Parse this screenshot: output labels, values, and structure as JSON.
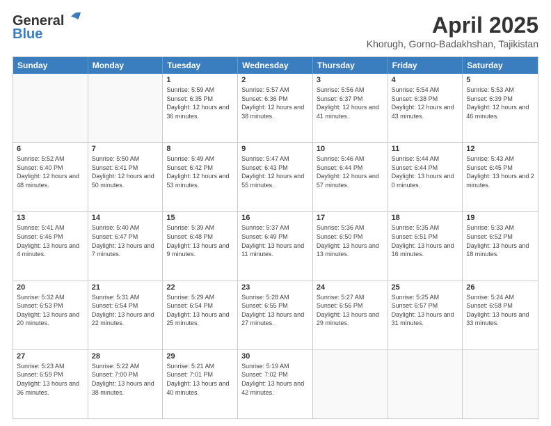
{
  "logo": {
    "line1": "General",
    "line2": "Blue"
  },
  "title": "April 2025",
  "subtitle": "Khorugh, Gorno-Badakhshan, Tajikistan",
  "headers": [
    "Sunday",
    "Monday",
    "Tuesday",
    "Wednesday",
    "Thursday",
    "Friday",
    "Saturday"
  ],
  "weeks": [
    [
      {
        "day": "",
        "info": ""
      },
      {
        "day": "",
        "info": ""
      },
      {
        "day": "1",
        "info": "Sunrise: 5:59 AM\nSunset: 6:35 PM\nDaylight: 12 hours and 36 minutes."
      },
      {
        "day": "2",
        "info": "Sunrise: 5:57 AM\nSunset: 6:36 PM\nDaylight: 12 hours and 38 minutes."
      },
      {
        "day": "3",
        "info": "Sunrise: 5:56 AM\nSunset: 6:37 PM\nDaylight: 12 hours and 41 minutes."
      },
      {
        "day": "4",
        "info": "Sunrise: 5:54 AM\nSunset: 6:38 PM\nDaylight: 12 hours and 43 minutes."
      },
      {
        "day": "5",
        "info": "Sunrise: 5:53 AM\nSunset: 6:39 PM\nDaylight: 12 hours and 46 minutes."
      }
    ],
    [
      {
        "day": "6",
        "info": "Sunrise: 5:52 AM\nSunset: 6:40 PM\nDaylight: 12 hours and 48 minutes."
      },
      {
        "day": "7",
        "info": "Sunrise: 5:50 AM\nSunset: 6:41 PM\nDaylight: 12 hours and 50 minutes."
      },
      {
        "day": "8",
        "info": "Sunrise: 5:49 AM\nSunset: 6:42 PM\nDaylight: 12 hours and 53 minutes."
      },
      {
        "day": "9",
        "info": "Sunrise: 5:47 AM\nSunset: 6:43 PM\nDaylight: 12 hours and 55 minutes."
      },
      {
        "day": "10",
        "info": "Sunrise: 5:46 AM\nSunset: 6:44 PM\nDaylight: 12 hours and 57 minutes."
      },
      {
        "day": "11",
        "info": "Sunrise: 5:44 AM\nSunset: 6:44 PM\nDaylight: 13 hours and 0 minutes."
      },
      {
        "day": "12",
        "info": "Sunrise: 5:43 AM\nSunset: 6:45 PM\nDaylight: 13 hours and 2 minutes."
      }
    ],
    [
      {
        "day": "13",
        "info": "Sunrise: 5:41 AM\nSunset: 6:46 PM\nDaylight: 13 hours and 4 minutes."
      },
      {
        "day": "14",
        "info": "Sunrise: 5:40 AM\nSunset: 6:47 PM\nDaylight: 13 hours and 7 minutes."
      },
      {
        "day": "15",
        "info": "Sunrise: 5:39 AM\nSunset: 6:48 PM\nDaylight: 13 hours and 9 minutes."
      },
      {
        "day": "16",
        "info": "Sunrise: 5:37 AM\nSunset: 6:49 PM\nDaylight: 13 hours and 11 minutes."
      },
      {
        "day": "17",
        "info": "Sunrise: 5:36 AM\nSunset: 6:50 PM\nDaylight: 13 hours and 13 minutes."
      },
      {
        "day": "18",
        "info": "Sunrise: 5:35 AM\nSunset: 6:51 PM\nDaylight: 13 hours and 16 minutes."
      },
      {
        "day": "19",
        "info": "Sunrise: 5:33 AM\nSunset: 6:52 PM\nDaylight: 13 hours and 18 minutes."
      }
    ],
    [
      {
        "day": "20",
        "info": "Sunrise: 5:32 AM\nSunset: 6:53 PM\nDaylight: 13 hours and 20 minutes."
      },
      {
        "day": "21",
        "info": "Sunrise: 5:31 AM\nSunset: 6:54 PM\nDaylight: 13 hours and 22 minutes."
      },
      {
        "day": "22",
        "info": "Sunrise: 5:29 AM\nSunset: 6:54 PM\nDaylight: 13 hours and 25 minutes."
      },
      {
        "day": "23",
        "info": "Sunrise: 5:28 AM\nSunset: 6:55 PM\nDaylight: 13 hours and 27 minutes."
      },
      {
        "day": "24",
        "info": "Sunrise: 5:27 AM\nSunset: 6:56 PM\nDaylight: 13 hours and 29 minutes."
      },
      {
        "day": "25",
        "info": "Sunrise: 5:25 AM\nSunset: 6:57 PM\nDaylight: 13 hours and 31 minutes."
      },
      {
        "day": "26",
        "info": "Sunrise: 5:24 AM\nSunset: 6:58 PM\nDaylight: 13 hours and 33 minutes."
      }
    ],
    [
      {
        "day": "27",
        "info": "Sunrise: 5:23 AM\nSunset: 6:59 PM\nDaylight: 13 hours and 36 minutes."
      },
      {
        "day": "28",
        "info": "Sunrise: 5:22 AM\nSunset: 7:00 PM\nDaylight: 13 hours and 38 minutes."
      },
      {
        "day": "29",
        "info": "Sunrise: 5:21 AM\nSunset: 7:01 PM\nDaylight: 13 hours and 40 minutes."
      },
      {
        "day": "30",
        "info": "Sunrise: 5:19 AM\nSunset: 7:02 PM\nDaylight: 13 hours and 42 minutes."
      },
      {
        "day": "",
        "info": ""
      },
      {
        "day": "",
        "info": ""
      },
      {
        "day": "",
        "info": ""
      }
    ]
  ]
}
